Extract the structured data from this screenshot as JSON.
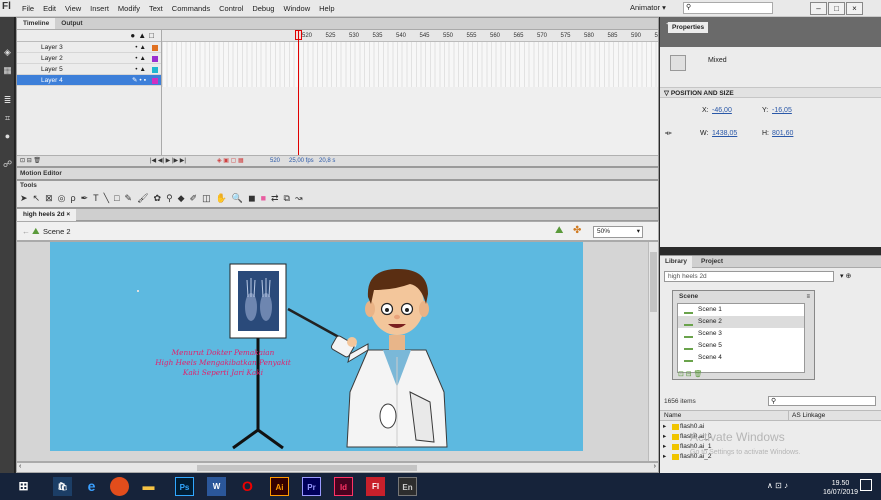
{
  "app": {
    "logo": "Fl"
  },
  "menu": [
    "File",
    "Edit",
    "View",
    "Insert",
    "Modify",
    "Text",
    "Commands",
    "Control",
    "Debug",
    "Window",
    "Help"
  ],
  "workspace": "Animator",
  "timeline": {
    "tabs": [
      "Timeline",
      "Output"
    ],
    "layers": [
      {
        "name": "Layer 3",
        "color": "#e07020"
      },
      {
        "name": "Layer 2",
        "color": "#9b30d0"
      },
      {
        "name": "Layer 5",
        "color": "#20b8d0"
      },
      {
        "name": "Layer 4",
        "color": "#d030c0"
      }
    ],
    "frame_numbers": [
      "520",
      "525",
      "530",
      "535",
      "540",
      "545",
      "550",
      "555",
      "560",
      "565",
      "570",
      "575",
      "580",
      "585",
      "590",
      "595",
      "600",
      "605",
      "610",
      "61"
    ],
    "current_frame": "520",
    "fps": "25,00 fps",
    "time": "20,8 s"
  },
  "panels": {
    "motion_editor": "Motion Editor",
    "tools_title": "Tools"
  },
  "document": {
    "tab": "high heels 2d",
    "scene": "Scene 2",
    "zoom": "50%"
  },
  "stage": {
    "caption_lines": [
      "Menurut Dokter Pemakaian",
      "High Heels Mengakibatkan Penyakit",
      "Kaki Seperti Jari Kaki"
    ]
  },
  "properties": {
    "title": "Properties",
    "mode": "Mixed",
    "section": "POSITION AND SIZE",
    "x_label": "X:",
    "x": "-46,00",
    "y_label": "Y:",
    "y": "-16,05",
    "w_label": "W:",
    "w": "1438,05",
    "h_label": "H:",
    "h": "801,60"
  },
  "library": {
    "tabs": [
      "Library",
      "Project"
    ],
    "selected": "high heels 2d",
    "count": "1656 items",
    "col_name": "Name",
    "col_link": "AS Linkage",
    "items": [
      "flash0.ai",
      "flash0.ai_0",
      "flash0.ai_1",
      "flash0.ai_2"
    ]
  },
  "scene_panel": {
    "title": "Scene",
    "scenes": [
      "Scene 1",
      "Scene 2",
      "Scene 3",
      "Scene 5",
      "Scene 4"
    ]
  },
  "watermark": {
    "title": "Activate Windows",
    "sub": "Go to Settings to activate Windows."
  },
  "clock": {
    "time": "19.50",
    "date": "16/07/2019"
  }
}
